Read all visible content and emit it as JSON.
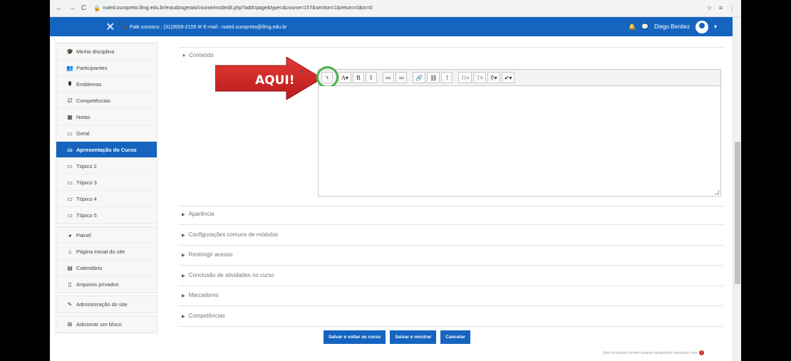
{
  "browser": {
    "url": "nuted.ouropreto.ifmg.edu.br/estudosgerais/course/modedit.php?add=page&type=&course=157&section=1&return=0&sr=0",
    "nav_icons": [
      "back-icon",
      "forward-icon",
      "reload-icon"
    ]
  },
  "navbar": {
    "close_symbol": "✕",
    "contact": "📞 Fale conosco : (31)3559-2155 ✉ E-mail : nuted.ouropreto@ifmg.edu.br",
    "user_name": "Diego Benitez",
    "color": "#1565c0"
  },
  "sidebar": {
    "groups": [
      [
        {
          "icon": "🎓",
          "label": "Minha disciplina"
        },
        {
          "icon": "👥",
          "label": "Participantes"
        },
        {
          "icon": "⬮",
          "label": "Emblemas"
        },
        {
          "icon": "☑",
          "label": "Competências"
        },
        {
          "icon": "▦",
          "label": "Notas"
        },
        {
          "icon": "▭",
          "label": "Geral"
        },
        {
          "icon": "▭",
          "label": "Apresentação do Curso",
          "active": true
        },
        {
          "icon": "▭",
          "label": "Tópico 2"
        },
        {
          "icon": "▭",
          "label": "Tópico 3"
        },
        {
          "icon": "▭",
          "label": "Tópico 4"
        },
        {
          "icon": "▭",
          "label": "Tópico 5"
        }
      ],
      [
        {
          "icon": "◕",
          "label": "Painel"
        },
        {
          "icon": "⌂",
          "label": "Página inicial do site"
        },
        {
          "icon": "▤",
          "label": "Calendário"
        },
        {
          "icon": "▯",
          "label": "Arquivos privados"
        }
      ],
      [
        {
          "icon": "✎",
          "label": "Administração do site"
        }
      ],
      [
        {
          "icon": "⊞",
          "label": "Adicionar um bloco"
        }
      ]
    ]
  },
  "main": {
    "section_title": "Conteúdo",
    "help_symbol": "?",
    "annotation": "AQUI!",
    "toolbar": [
      "⤵",
      "A▾",
      "B",
      "I",
      "≔",
      "≕",
      "🔗",
      "⛓",
      "!",
      "H▾",
      "T▾",
      "⚲▾",
      "✔▾"
    ],
    "collapsed_sections": [
      "Aparência",
      "Configurações comuns de módulos",
      "Restringir acesso",
      "Conclusão de atividades no curso",
      "Marcadores",
      "Competências"
    ],
    "buttons": {
      "save_return": "Salvar e voltar ao curso",
      "save_show": "Salvar e mostrar",
      "cancel": "Cancelar"
    },
    "footnote": "Este formulário contém campos obrigatórios marcados com"
  }
}
